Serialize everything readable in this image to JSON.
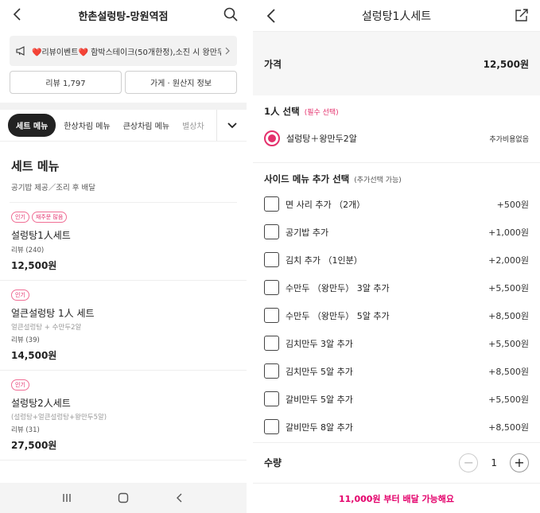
{
  "left": {
    "title": "한촌설렁탕-망원역점",
    "notice": "❤️리뷰이벤트❤️ 함박스테이크(50개한정),소진 시 왕만두 ...",
    "review_button": "리뷰 1,797",
    "store_info_button": "가게 · 원산지 정보",
    "tabs": [
      "세트 메뉴",
      "한상차림 메뉴",
      "큰상차림 메뉴",
      "별상차"
    ],
    "section_title": "세트 메뉴",
    "section_sub": "공기밥 제공／조리 후 배달",
    "items": [
      {
        "badges": [
          "인기",
          "재주문 많음"
        ],
        "name": "설렁탕1人세트",
        "desc": "",
        "review": "리뷰 (240)",
        "price": "12,500원"
      },
      {
        "badges": [
          "인기"
        ],
        "name": "얼큰설렁탕 1人 세트",
        "desc": "얼큰설렁탕 + 수만두2알",
        "review": "리뷰 (39)",
        "price": "14,500원"
      },
      {
        "badges": [
          "인기"
        ],
        "name": "설렁탕2人세트",
        "desc": "(설렁탕+얼큰설렁탕+왕만두5알)",
        "review": "리뷰 (31)",
        "price": "27,500원"
      }
    ]
  },
  "right": {
    "title": "설렁탕1人세트",
    "price_label": "가격",
    "price_value": "12,500원",
    "option1_title": "1人 선택",
    "option1_req": "(필수 선택)",
    "option1_choice": "설렁탕＋왕만두2알",
    "option1_extra": "추가비용없음",
    "side_title": "사이드 메뉴 추가 선택",
    "side_optional": "(추가선택 가능)",
    "side_items": [
      {
        "name": "면 사리 추가 （2개）",
        "price": "+500원"
      },
      {
        "name": "공기밥 추가",
        "price": "+1,000원"
      },
      {
        "name": "김치 추가 （1인분）",
        "price": "+2,000원"
      },
      {
        "name": "수만두 （왕만두） 3알 추가",
        "price": "+5,500원"
      },
      {
        "name": "수만두 （왕만두） 5알 추가",
        "price": "+8,500원"
      },
      {
        "name": "김치만두 3알 추가",
        "price": "+5,500원"
      },
      {
        "name": "김치만두 5알 추가",
        "price": "+8,500원"
      },
      {
        "name": "갈비만두 5알 추가",
        "price": "+5,500원"
      },
      {
        "name": "갈비만두 8알 추가",
        "price": "+8,500원"
      }
    ],
    "qty_label": "수량",
    "qty_minus": "−",
    "qty_value": "1",
    "qty_plus": "+",
    "footer": "11,000원 부터 배달 가능해요"
  },
  "colors": {
    "accent": "#e4306c",
    "footer_text": "#e4006b"
  }
}
